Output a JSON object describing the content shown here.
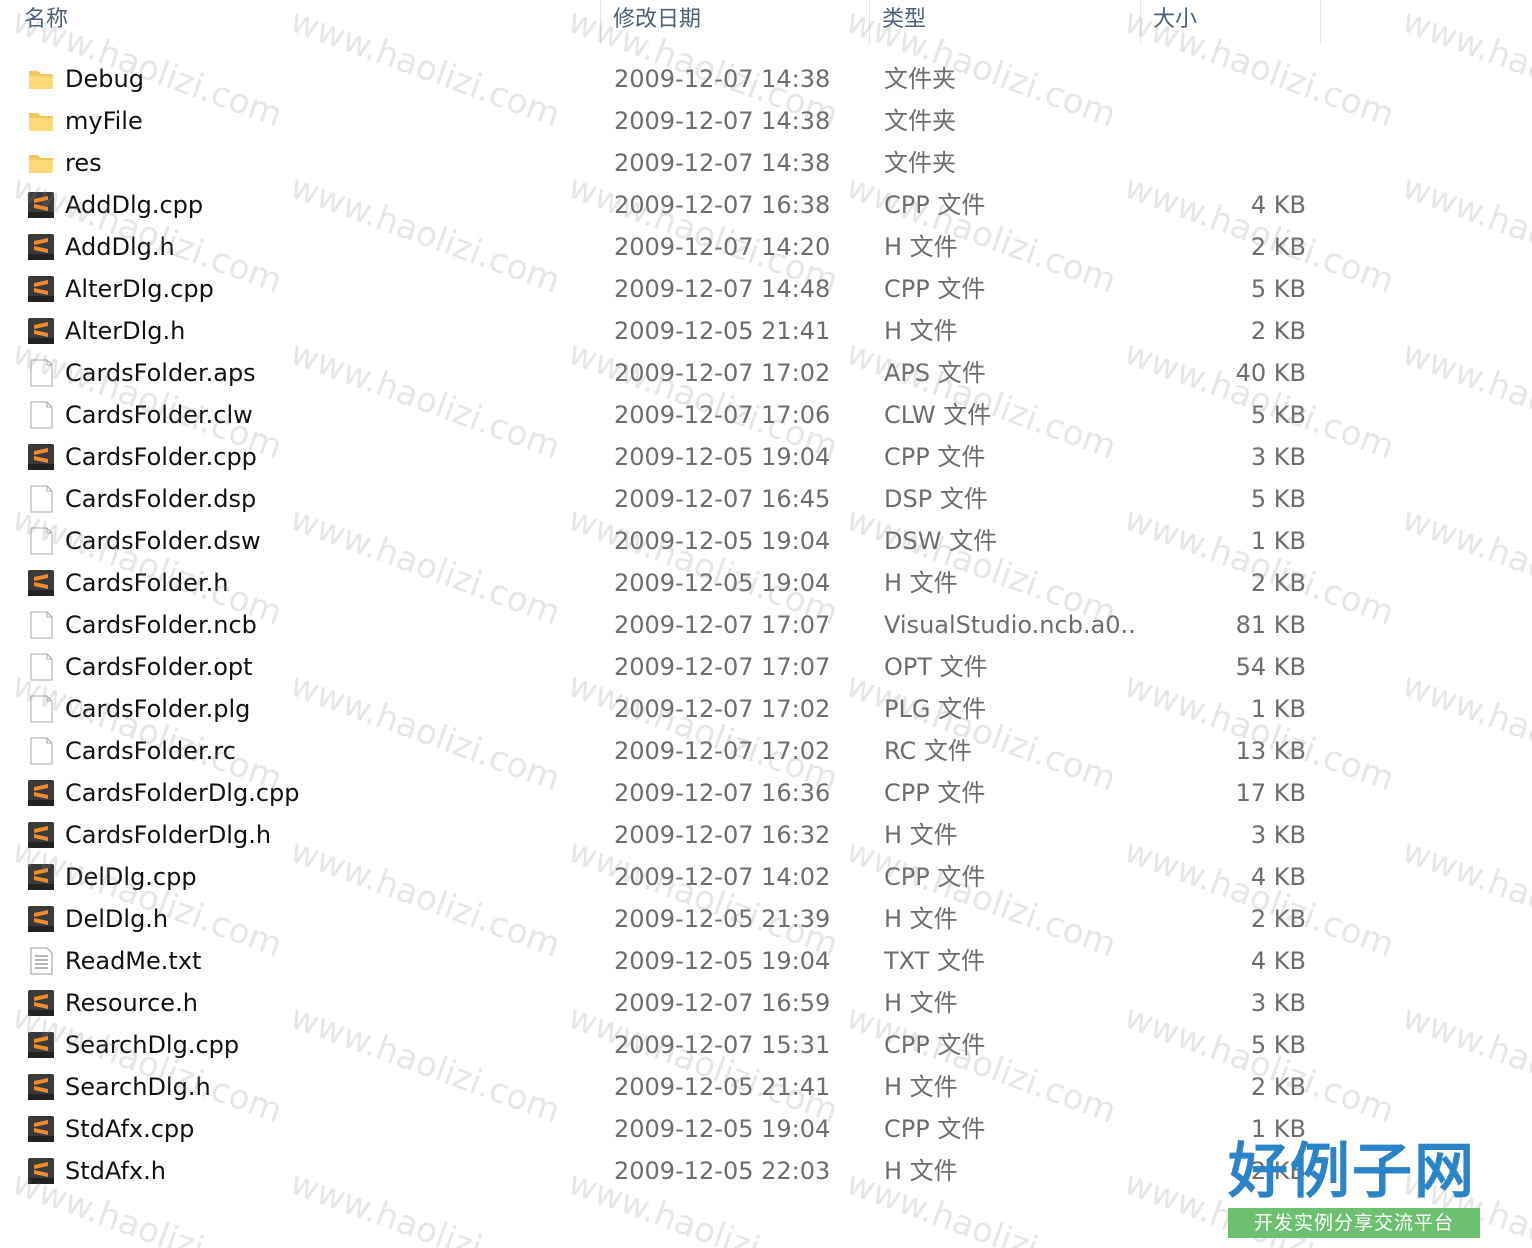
{
  "columns": {
    "name": "名称",
    "date": "修改日期",
    "type": "类型",
    "size": "大小"
  },
  "files": [
    {
      "name": "Debug",
      "date": "2009-12-07 14:38",
      "type": "文件夹",
      "size": "",
      "icon": "folder-icon"
    },
    {
      "name": "myFile",
      "date": "2009-12-07 14:38",
      "type": "文件夹",
      "size": "",
      "icon": "folder-icon"
    },
    {
      "name": "res",
      "date": "2009-12-07 14:38",
      "type": "文件夹",
      "size": "",
      "icon": "folder-icon"
    },
    {
      "name": "AddDlg.cpp",
      "date": "2009-12-07 16:38",
      "type": "CPP 文件",
      "size": "4 KB",
      "icon": "sublime-file-icon"
    },
    {
      "name": "AddDlg.h",
      "date": "2009-12-07 14:20",
      "type": "H 文件",
      "size": "2 KB",
      "icon": "sublime-file-icon"
    },
    {
      "name": "AlterDlg.cpp",
      "date": "2009-12-07 14:48",
      "type": "CPP 文件",
      "size": "5 KB",
      "icon": "sublime-file-icon"
    },
    {
      "name": "AlterDlg.h",
      "date": "2009-12-05 21:41",
      "type": "H 文件",
      "size": "2 KB",
      "icon": "sublime-file-icon"
    },
    {
      "name": "CardsFolder.aps",
      "date": "2009-12-07 17:02",
      "type": "APS 文件",
      "size": "40 KB",
      "icon": "blank-file-icon"
    },
    {
      "name": "CardsFolder.clw",
      "date": "2009-12-07 17:06",
      "type": "CLW 文件",
      "size": "5 KB",
      "icon": "blank-file-icon"
    },
    {
      "name": "CardsFolder.cpp",
      "date": "2009-12-05 19:04",
      "type": "CPP 文件",
      "size": "3 KB",
      "icon": "sublime-file-icon"
    },
    {
      "name": "CardsFolder.dsp",
      "date": "2009-12-07 16:45",
      "type": "DSP 文件",
      "size": "5 KB",
      "icon": "blank-file-icon"
    },
    {
      "name": "CardsFolder.dsw",
      "date": "2009-12-05 19:04",
      "type": "DSW 文件",
      "size": "1 KB",
      "icon": "blank-file-icon"
    },
    {
      "name": "CardsFolder.h",
      "date": "2009-12-05 19:04",
      "type": "H 文件",
      "size": "2 KB",
      "icon": "sublime-file-icon"
    },
    {
      "name": "CardsFolder.ncb",
      "date": "2009-12-07 17:07",
      "type": "VisualStudio.ncb.a0...",
      "size": "81 KB",
      "icon": "blank-file-icon"
    },
    {
      "name": "CardsFolder.opt",
      "date": "2009-12-07 17:07",
      "type": "OPT 文件",
      "size": "54 KB",
      "icon": "blank-file-icon"
    },
    {
      "name": "CardsFolder.plg",
      "date": "2009-12-07 17:02",
      "type": "PLG 文件",
      "size": "1 KB",
      "icon": "blank-file-icon"
    },
    {
      "name": "CardsFolder.rc",
      "date": "2009-12-07 17:02",
      "type": "RC 文件",
      "size": "13 KB",
      "icon": "blank-file-icon"
    },
    {
      "name": "CardsFolderDlg.cpp",
      "date": "2009-12-07 16:36",
      "type": "CPP 文件",
      "size": "17 KB",
      "icon": "sublime-file-icon"
    },
    {
      "name": "CardsFolderDlg.h",
      "date": "2009-12-07 16:32",
      "type": "H 文件",
      "size": "3 KB",
      "icon": "sublime-file-icon"
    },
    {
      "name": "DelDlg.cpp",
      "date": "2009-12-07 14:02",
      "type": "CPP 文件",
      "size": "4 KB",
      "icon": "sublime-file-icon"
    },
    {
      "name": "DelDlg.h",
      "date": "2009-12-05 21:39",
      "type": "H 文件",
      "size": "2 KB",
      "icon": "sublime-file-icon"
    },
    {
      "name": "ReadMe.txt",
      "date": "2009-12-05 19:04",
      "type": "TXT 文件",
      "size": "4 KB",
      "icon": "text-file-icon"
    },
    {
      "name": "Resource.h",
      "date": "2009-12-07 16:59",
      "type": "H 文件",
      "size": "3 KB",
      "icon": "sublime-file-icon"
    },
    {
      "name": "SearchDlg.cpp",
      "date": "2009-12-07 15:31",
      "type": "CPP 文件",
      "size": "5 KB",
      "icon": "sublime-file-icon"
    },
    {
      "name": "SearchDlg.h",
      "date": "2009-12-05 21:41",
      "type": "H 文件",
      "size": "2 KB",
      "icon": "sublime-file-icon"
    },
    {
      "name": "StdAfx.cpp",
      "date": "2009-12-05 19:04",
      "type": "CPP 文件",
      "size": "1 KB",
      "icon": "sublime-file-icon"
    },
    {
      "name": "StdAfx.h",
      "date": "2009-12-05 22:03",
      "type": "H 文件",
      "size": "2 KB",
      "icon": "sublime-file-icon"
    }
  ],
  "watermark": {
    "text": "www.haolizi.com"
  },
  "brand": {
    "title": "好例子网",
    "subtitle": "开发实例分享交流平台"
  },
  "colors": {
    "folder": "#f4c858",
    "sublime_bg": "#3a3a3a",
    "sublime_accent": "#f28c28"
  }
}
